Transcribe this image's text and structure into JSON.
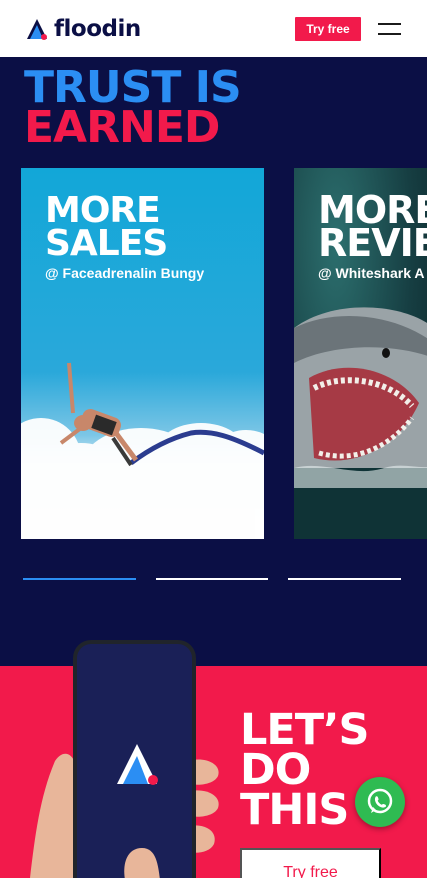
{
  "header": {
    "brand": "floodin",
    "try_label": "Try free",
    "menu_icon": "hamburger-menu-icon"
  },
  "hero": {
    "line1": "TRUST IS",
    "line2": "EARNED",
    "colors": {
      "blue": "#2b8ef3",
      "pink": "#f21a4b",
      "navy": "#0b0f45"
    }
  },
  "cards": [
    {
      "title": "MORE\nSALES",
      "subtitle": "@ Faceadrenalin Bungy"
    },
    {
      "title": "MORE\nREVIE",
      "subtitle": "@ Whiteshark A"
    }
  ],
  "carousel": {
    "active_index": 0,
    "count": 3
  },
  "cta": {
    "title": "LET’S\nDO\nTHIS",
    "button_label": "Try free"
  },
  "floating": {
    "icon": "whatsapp-icon",
    "color": "#2fbb52"
  }
}
